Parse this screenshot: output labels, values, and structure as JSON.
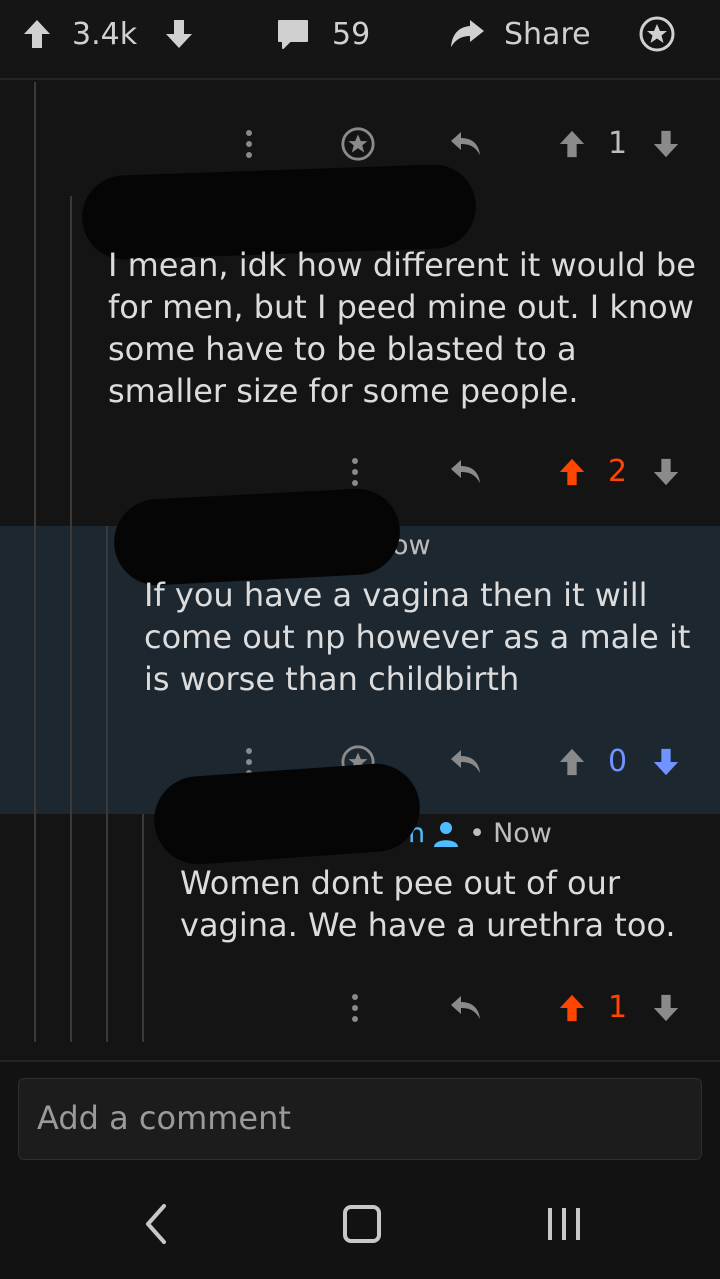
{
  "post_bar": {
    "score": "3.4k",
    "comments": "59",
    "share_label": "Share",
    "icons": [
      "upvote-icon",
      "downvote-icon",
      "comment-icon",
      "share-arrow-icon",
      "award-icon"
    ]
  },
  "comments": [
    {
      "id": "c1",
      "text": "I mean, idk how different it would be for men, but I peed mine out. I know some have to be blasted to a smaller size for some people.",
      "score": "2",
      "vote_state": "up",
      "colors": {
        "upvoted": "#ff4500"
      }
    },
    {
      "id": "c2",
      "meta_time": "ow",
      "text": "If you have a vagina then it will come out np however  as a male it is worse than childbirth",
      "score": "0",
      "vote_state": "down",
      "colors": {
        "downvoted": "#7193ff"
      }
    },
    {
      "id": "c3",
      "meta_author_fragment": "n",
      "meta_separator": "•",
      "meta_time": "Now",
      "text": "Women dont pee out of our vagina. We have a urethra too.",
      "score": "1",
      "vote_state": "up"
    }
  ],
  "parent_actions": {
    "score": "1"
  },
  "composer": {
    "placeholder": "Add a comment"
  },
  "navbar": {
    "icons": [
      "back-icon",
      "home-icon",
      "recents-icon"
    ]
  }
}
